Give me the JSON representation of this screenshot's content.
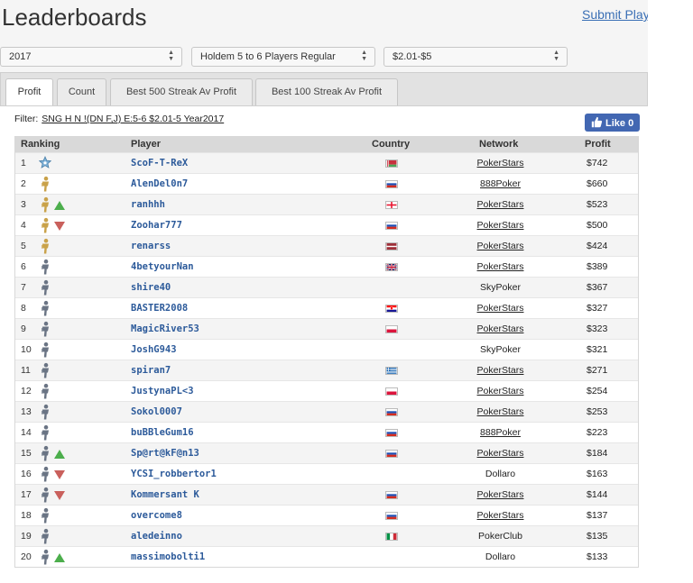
{
  "page": {
    "title": "Leaderboards",
    "submit_link": "Submit Playe"
  },
  "filters": {
    "year": "2017",
    "game": "Holdem 5 to 6 Players Regular",
    "stakes": "$2.01-$5"
  },
  "tabs": [
    {
      "label": "Profit",
      "active": true
    },
    {
      "label": "Count",
      "active": false
    },
    {
      "label": "Best 500 Streak Av Profit",
      "active": false
    },
    {
      "label": "Best 100 Streak Av Profit",
      "active": false
    }
  ],
  "filter_line": {
    "label": "Filter:",
    "value": "SNG H N !(DN F,J) E:5-6 $2.01-5 Year2017"
  },
  "like_button": {
    "label": "Like 0",
    "icon": "thumbs-up-icon"
  },
  "table": {
    "headers": [
      "Ranking",
      "Player",
      "Country",
      "Network",
      "Profit"
    ],
    "rows": [
      {
        "rank": "1",
        "icon": "star-badge",
        "trend": "",
        "player": "ScoF-T-ReX",
        "flag": "by",
        "network": "PokerStars",
        "network_link": true,
        "profit": "$742"
      },
      {
        "rank": "2",
        "icon": "gold-badge",
        "trend": "",
        "player": "AlenDel0n7",
        "flag": "ru",
        "network": "888Poker",
        "network_link": true,
        "profit": "$660"
      },
      {
        "rank": "3",
        "icon": "gold-badge",
        "trend": "up",
        "player": "ranhhh",
        "flag": "ge",
        "network": "PokerStars",
        "network_link": true,
        "profit": "$523"
      },
      {
        "rank": "4",
        "icon": "gold-badge",
        "trend": "down",
        "player": "Zoohar777",
        "flag": "ru",
        "network": "PokerStars",
        "network_link": true,
        "profit": "$500"
      },
      {
        "rank": "5",
        "icon": "gold-badge",
        "trend": "",
        "player": "renarss",
        "flag": "lv",
        "network": "PokerStars",
        "network_link": true,
        "profit": "$424"
      },
      {
        "rank": "6",
        "icon": "silver-badge",
        "trend": "",
        "player": "4betyourNan",
        "flag": "gb",
        "network": "PokerStars",
        "network_link": true,
        "profit": "$389"
      },
      {
        "rank": "7",
        "icon": "silver-badge",
        "trend": "",
        "player": "shire40",
        "flag": "",
        "network": "SkyPoker",
        "network_link": false,
        "profit": "$367"
      },
      {
        "rank": "8",
        "icon": "silver-badge",
        "trend": "",
        "player": "BASTER2008",
        "flag": "hr",
        "network": "PokerStars",
        "network_link": true,
        "profit": "$327"
      },
      {
        "rank": "9",
        "icon": "silver-badge",
        "trend": "",
        "player": "MagicRiver53",
        "flag": "pl",
        "network": "PokerStars",
        "network_link": true,
        "profit": "$323"
      },
      {
        "rank": "10",
        "icon": "silver-badge",
        "trend": "",
        "player": "JoshG943",
        "flag": "",
        "network": "SkyPoker",
        "network_link": false,
        "profit": "$321"
      },
      {
        "rank": "11",
        "icon": "silver-badge",
        "trend": "",
        "player": "spiran7",
        "flag": "gr",
        "network": "PokerStars",
        "network_link": true,
        "profit": "$271"
      },
      {
        "rank": "12",
        "icon": "silver-badge",
        "trend": "",
        "player": "JustynaPL<3",
        "flag": "pl",
        "network": "PokerStars",
        "network_link": true,
        "profit": "$254"
      },
      {
        "rank": "13",
        "icon": "silver-badge",
        "trend": "",
        "player": "Sokol0007",
        "flag": "ru",
        "network": "PokerStars",
        "network_link": true,
        "profit": "$253"
      },
      {
        "rank": "14",
        "icon": "silver-badge",
        "trend": "",
        "player": "buBBleGum16",
        "flag": "ru",
        "network": "888Poker",
        "network_link": true,
        "profit": "$223"
      },
      {
        "rank": "15",
        "icon": "silver-badge",
        "trend": "up",
        "player": "Sp@rt@kF@n13",
        "flag": "ru",
        "network": "PokerStars",
        "network_link": true,
        "profit": "$184"
      },
      {
        "rank": "16",
        "icon": "silver-badge",
        "trend": "down",
        "player": "YCSI_robbertor1",
        "flag": "",
        "network": "Dollaro",
        "network_link": false,
        "profit": "$163"
      },
      {
        "rank": "17",
        "icon": "silver-badge",
        "trend": "down",
        "player": "Kommersant K",
        "flag": "ru",
        "network": "PokerStars",
        "network_link": true,
        "profit": "$144"
      },
      {
        "rank": "18",
        "icon": "silver-badge",
        "trend": "",
        "player": "overcome8",
        "flag": "ru",
        "network": "PokerStars",
        "network_link": true,
        "profit": "$137"
      },
      {
        "rank": "19",
        "icon": "silver-badge",
        "trend": "",
        "player": "aledeinno",
        "flag": "it",
        "network": "PokerClub",
        "network_link": false,
        "profit": "$135"
      },
      {
        "rank": "20",
        "icon": "silver-badge",
        "trend": "up",
        "player": "massimobolti1",
        "flag": "",
        "network": "Dollaro",
        "network_link": false,
        "profit": "$133"
      }
    ]
  },
  "colors": {
    "link": "#2c5a9a",
    "facebook": "#4267b2",
    "trend_up": "#4cae4c",
    "trend_down": "#c9605c",
    "gold": "#c9a24a",
    "silver": "#6a7484"
  }
}
